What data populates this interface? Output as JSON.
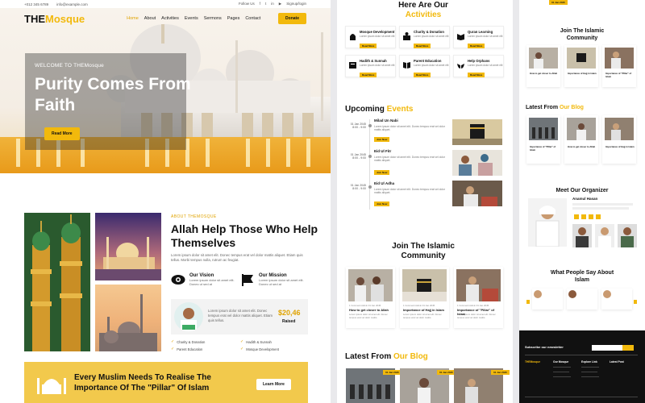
{
  "topbar": {
    "phone": "+012 345 6789",
    "email": "info@example.com",
    "follow": "Follow Us",
    "signup": "Signup/login"
  },
  "nav": {
    "logo_a": "THE",
    "logo_b": "Mosque",
    "items": [
      "Home",
      "About",
      "Activities",
      "Events",
      "Sermons",
      "Pages",
      "Contact"
    ],
    "donate": "Donate"
  },
  "hero": {
    "welcome": "WELCOME TO THEMosque",
    "title": "Purity Comes From Faith",
    "button": "Read More"
  },
  "about": {
    "tag": "ABOUT THEMOSQUE",
    "title": "Allah Help Those Who Help Themselves",
    "text": "Lorem ipsum dolor sit amet elit. Donec tempus erat vel dolor mattis aliquet. Etiam quis tellus. Morbi tempus nulla, rutrum ac feugiat.",
    "vision_title": "Our Vision",
    "vision_text": "Lorem ipsum dolor sit amet elit. Donec ut sed at",
    "mission_title": "Our Mission",
    "mission_text": "Lorem ipsum dolor sit amet elit. Donec ut sed at",
    "raised_text": "Lorem ipsum dolor sit amet elit. Donec tempus erat vel dolor mattis aliquet. Etiam quis tellus.",
    "raised_amount": "$20,46",
    "raised_label": "Raised",
    "features": [
      "Charity & Donation",
      "Hadith & Sunnah",
      "Parent Education",
      "Mosque Development"
    ]
  },
  "banner": {
    "text": "Every Muslim Needs To Realise The Importance Of The \"Pillar\" Of Islam",
    "button": "Learn More"
  },
  "activities": {
    "heading_a": "Here Are Our",
    "heading_b": "Activities",
    "cards": [
      {
        "title": "Mosque Development",
        "desc": "Lorem ipsum dolor sit amet elit",
        "button": "Read More"
      },
      {
        "title": "Charity & Donation",
        "desc": "Lorem ipsum dolor sit amet elit",
        "button": "Read More"
      },
      {
        "title": "Quran Learning",
        "desc": "Lorem ipsum dolor sit amet elit",
        "button": "Read More"
      },
      {
        "title": "Hadith & Sunnah",
        "desc": "Lorem ipsum dolor sit amet elit",
        "button": "Read More"
      },
      {
        "title": "Parent Education",
        "desc": "Lorem ipsum dolor sit amet elit",
        "button": "Read More"
      },
      {
        "title": "Help Orphans",
        "desc": "Lorem ipsum dolor sit amet elit",
        "button": "Read More"
      }
    ]
  },
  "events": {
    "heading_a": "Upcoming",
    "heading_b": "Events",
    "items": [
      {
        "date": "01 Jan 2045",
        "time": "8:00 - 9:00",
        "title": "Milad Un Nabi",
        "desc": "Lorem ipsum dolor sit amet elit. Donec tempus erat vel dolor mattis aliquet.",
        "button": "Join Now"
      },
      {
        "date": "01 Jan 2045",
        "time": "8:00 - 9:00",
        "title": "Eid Ul Fitr",
        "desc": "Lorem ipsum dolor sit amet elit. Donec tempus erat vel dolor mattis aliquet.",
        "button": "Join Now"
      },
      {
        "date": "01 Jan 2045",
        "time": "8:00 - 9:00",
        "title": "Eid Ul Adha",
        "desc": "Lorem ipsum dolor sit amet elit. Donec tempus erat vel dolor mattis aliquet.",
        "button": "Join Now"
      }
    ]
  },
  "community": {
    "heading_a": "Join The Islamic",
    "heading_b": "Community",
    "cards": [
      {
        "title": "How to get closer to Allah",
        "meta": "1 Comment  Admin  01 Jan 2045",
        "desc": "Lorem ipsum dolor sit amet elit. Donec tempus erat vel dolor mattis."
      },
      {
        "title": "Importance of Hajj in Islam",
        "meta": "1 Comment  Admin  01 Jan 2045",
        "desc": "Lorem ipsum dolor sit amet elit. Donec tempus erat vel dolor mattis."
      },
      {
        "title": "Importance of \"Pillar\" of Islam",
        "meta": "1 Comment  Admin  01 Jan 2045",
        "desc": "Lorem ipsum dolor sit amet elit. Donec tempus erat vel dolor mattis."
      }
    ]
  },
  "blog": {
    "heading_a": "Latest From",
    "heading_b": "Our Blog",
    "badges": [
      "01 Jan 2045",
      "01 Jan 2045",
      "01 Jan 2045"
    ]
  },
  "organizer": {
    "heading": "Meet Our Organizer",
    "name": "Anamul Hasan"
  },
  "testimonial": {
    "heading": "What People Say About Islam"
  },
  "footer": {
    "newsletter": "Subscribe our newsletter",
    "cols": [
      "THEMosque",
      "Our Mosque",
      "Explore Link",
      "Latest Post"
    ]
  },
  "colors": {
    "accent": "#f2b90c",
    "dark": "#111111"
  }
}
